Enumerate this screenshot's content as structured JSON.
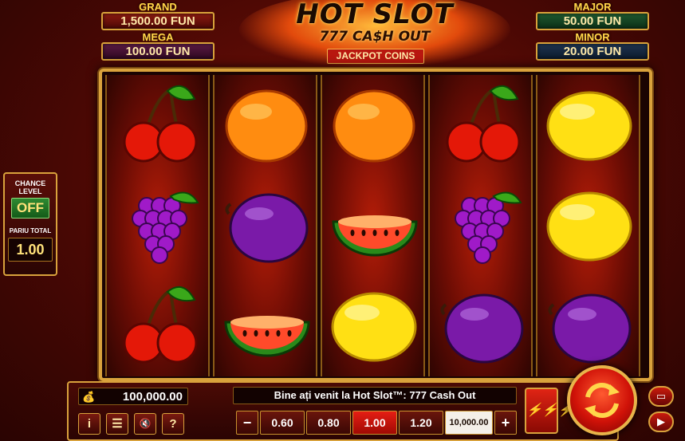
{
  "jackpots": {
    "grand": {
      "title": "GRAND",
      "value": "1,500.00 FUN"
    },
    "mega": {
      "title": "MEGA",
      "value": "100.00 FUN"
    },
    "major": {
      "title": "MAJOR",
      "value": "50.00 FUN"
    },
    "minor": {
      "title": "MINOR",
      "value": "20.00 FUN"
    }
  },
  "logo": {
    "title": "HOT SLOT",
    "subtitle": "777 CA$H OUT",
    "coins_label": "JACKPOT COINS"
  },
  "reels": [
    [
      "cherries",
      "grapes",
      "cherries"
    ],
    [
      "orange",
      "plum",
      "watermelon"
    ],
    [
      "orange",
      "watermelon",
      "lemon"
    ],
    [
      "cherries",
      "grapes",
      "plum"
    ],
    [
      "lemon",
      "lemon",
      "plum"
    ]
  ],
  "chance": {
    "label": "CHANCE LEVEL",
    "state": "OFF"
  },
  "total_bet": {
    "label": "PARIU TOTAL",
    "value": "1.00"
  },
  "balance": {
    "icon": "money-bag-icon",
    "value": "100,000.00"
  },
  "message": "Bine ați venit la Hot Slot™: 777 Cash Out",
  "bets": {
    "minus": "−",
    "options": [
      "0.60",
      "0.80",
      "1.00",
      "1.20",
      "10,000.00"
    ],
    "selected": "1.00",
    "plus": "+"
  },
  "buttons": {
    "info": "i",
    "menu": "☰",
    "sound": "🔇",
    "help": "?",
    "turbo": "⚡⚡⚡"
  },
  "colors": {
    "accent_gold": "#d9a23c",
    "spin_red": "#d01208",
    "chance_green": "#2f8a32"
  }
}
